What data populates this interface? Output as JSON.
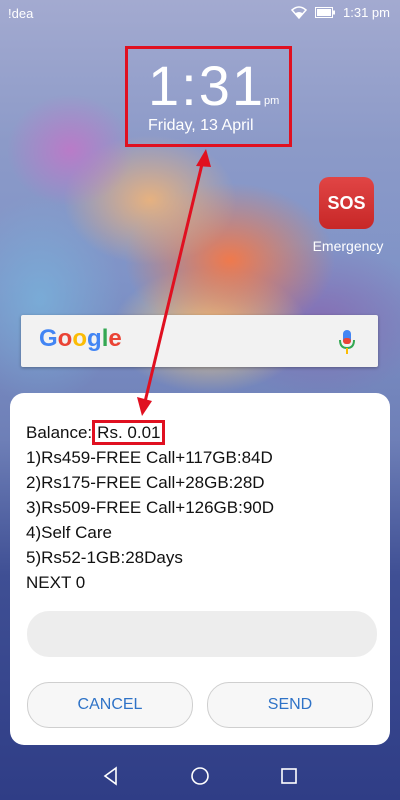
{
  "status_bar": {
    "carrier": "!dea",
    "time": "1:31 pm",
    "icons": [
      "wifi-icon",
      "battery-icon"
    ]
  },
  "lockscreen": {
    "time": "1:31",
    "ampm": "pm",
    "date": "Friday, 13 April"
  },
  "shortcut": {
    "icon_text": "SOS",
    "label": "Emergency"
  },
  "google_bar": {
    "logo": "Google",
    "mic_icon": "mic-icon"
  },
  "ussd_dialog": {
    "balance_label": "Balance:",
    "balance_value": "Rs. 0.01",
    "options": [
      "1)Rs459-FREE Call+117GB:84D",
      "2)Rs175-FREE Call+28GB:28D",
      "3)Rs509-FREE Call+126GB:90D",
      "4)Self Care",
      "5)Rs52-1GB:28Days",
      "NEXT 0"
    ],
    "input_value": "",
    "cancel_label": "CANCEL",
    "send_label": "SEND"
  },
  "colors": {
    "highlight_red": "#e01020",
    "button_text_blue": "#2f73c7"
  }
}
